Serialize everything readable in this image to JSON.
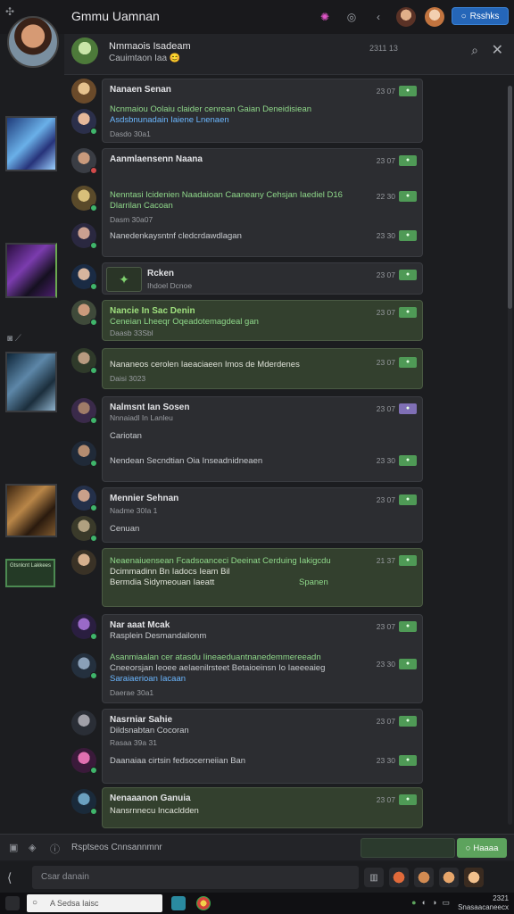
{
  "window": {
    "title": "Gmmu Uamnan"
  },
  "topbar": {
    "refresh_label": "Rsshks"
  },
  "channel": {
    "name": "Nmmaois Isadeam",
    "status": "Cauimtaon Iaa",
    "meta": "2311  13"
  },
  "messages": [
    {
      "name": "Nanaen Senan",
      "time": "23 07",
      "tag": "",
      "lines": [
        "Ncnmaiou Oolaiu claider cenrean Gaian  Deneidisiean",
        "Asdsbnunadain Iaiene Lnenaen",
        "Dasdo 30a1"
      ]
    },
    {
      "name": "Aanmlaensenn Naana",
      "time": "23 07",
      "tag": "",
      "lines": [
        "Nenntasi Icidenien Naadaioan Caaneany Cehsjan Iaediel D16",
        "Dlarrilan Cacoan",
        "Dasm 30a07",
        "Nanedenkaysntnf cledcrdawdlagan"
      ],
      "times2": [
        "22 30",
        "23 30"
      ]
    },
    {
      "name": "Rcken",
      "time": "23 07",
      "tag": "",
      "lines": [
        "Ihdoel Dcnoe"
      ]
    },
    {
      "name": "Nancie In Sac Denin",
      "time": "23 07",
      "tag": "",
      "lines": [
        "Ceneian   Lheeqr Oqeadotemagdeal gan",
        "Daasb 33Sbl"
      ]
    },
    {
      "name": "",
      "time": "23 07",
      "tag": "",
      "lines": [
        "Nananeos cerolen Iaeaciaeen Imos de Mderdenes",
        "Daisi 3023"
      ]
    },
    {
      "name": "Nalmsnt Ian Sosen",
      "time": "23 07",
      "tag": "",
      "lines": [
        "Nnnaiadl In Lanleu",
        "Cariotan",
        "Nendean Secndtian Oia Inseadnidneaen"
      ],
      "time2": "23 30"
    },
    {
      "name": "Mennier Sehnan",
      "time": "23 07",
      "tag": "",
      "lines": [
        "Nadme 30Ia  1",
        "Cenuan"
      ]
    },
    {
      "name": "",
      "time": "21 37",
      "tag": "",
      "lines": [
        "Neaenaiuensean Fcadsoanceci Deeinat Cerduing Iakigcdu",
        "Dcimmadinn Bn Iadocs Ieam Bil",
        "Bermdia Sidymeouan Iaeatt",
        "Spanen"
      ]
    },
    {
      "name": "Nar aaat Mcak",
      "time": "23 07",
      "tag": "",
      "lines": [
        "Rasplein Desmandailonm",
        "Asanmiaalan cer atasdu Iineaeduantnanedemmereeadn",
        "Cneeorsjan Ieoee aelaenilrsteet Betaioeinsn  Io Iaeeeaieg",
        "Saraiaerioan  Iacaan",
        "Daerae 30a1"
      ],
      "time2": "23 30"
    },
    {
      "name": "Nasrniar Sahie",
      "time": "23 07",
      "tag": "",
      "lines": [
        "Dildsnabtan Cocoran",
        "Rasaa 39a 31",
        "Daanaiaa cirtsin fedsocerneiian Ban"
      ],
      "time2": "23 30"
    },
    {
      "name": "Nenaaanon Ganuia",
      "time": "23 07",
      "tag": "",
      "lines": [
        "Nansrnnecu Incacldden"
      ]
    }
  ],
  "thumbs": {
    "badge": "Gtsnlcnt Lakkees"
  },
  "composer": {
    "label": "Rsptseos Cnnsannmnr",
    "send_label": "Haaaa"
  },
  "search": {
    "placeholder": "Csar danain"
  },
  "taskbar": {
    "search_placeholder": "A Sedsa Iaisc",
    "time": "2321",
    "date": "Snasaacaneecx"
  },
  "colors": {
    "accent_blue": "#2566b8",
    "accent_green": "#5da35d",
    "online": "#3fb56b"
  }
}
